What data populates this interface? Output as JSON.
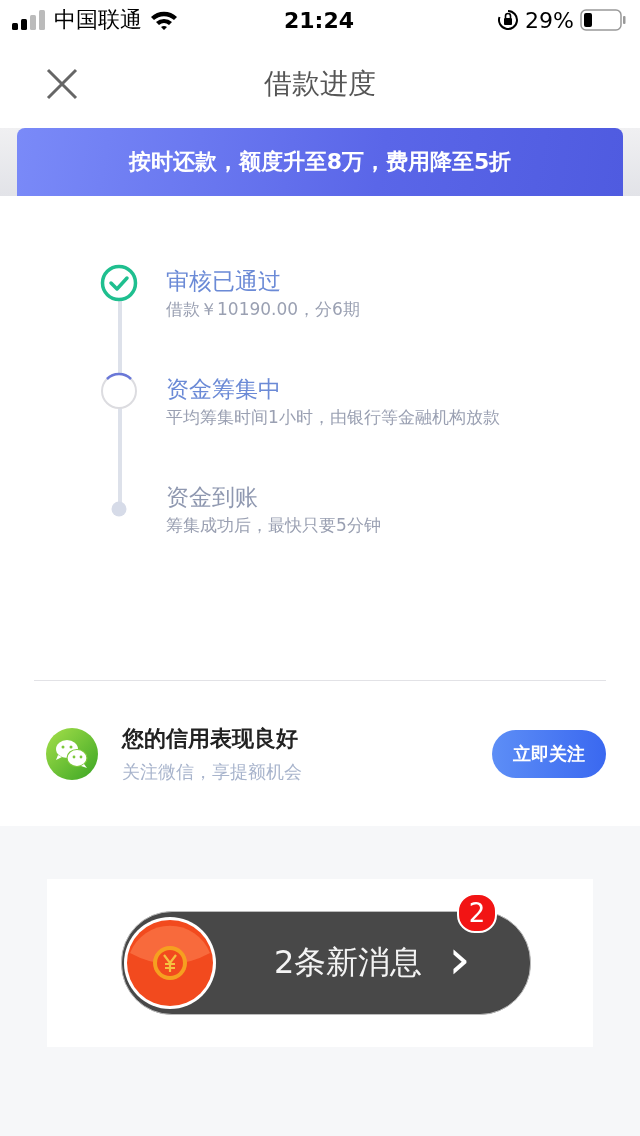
{
  "status_bar": {
    "carrier": "中国联通",
    "time": "21:24",
    "battery": "29%"
  },
  "nav": {
    "title": "借款进度"
  },
  "banner": {
    "text": "按时还款，额度升至8万，费用降至5折"
  },
  "steps": [
    {
      "kind": "done",
      "title": "审核已通过",
      "detail": "借款￥10190.00，分6期"
    },
    {
      "kind": "active",
      "title": "资金筹集中",
      "detail": "平均筹集时间1小时，由银行等金融机构放款"
    },
    {
      "kind": "pending",
      "title": "资金到账",
      "detail": "筹集成功后，最快只要5分钟"
    }
  ],
  "credit": {
    "title": "您的信用表现良好",
    "subtitle": "关注微信，享提额机会",
    "button": "立即关注"
  },
  "message": {
    "badge": "2",
    "text": "2条新消息",
    "arrow": "›"
  }
}
